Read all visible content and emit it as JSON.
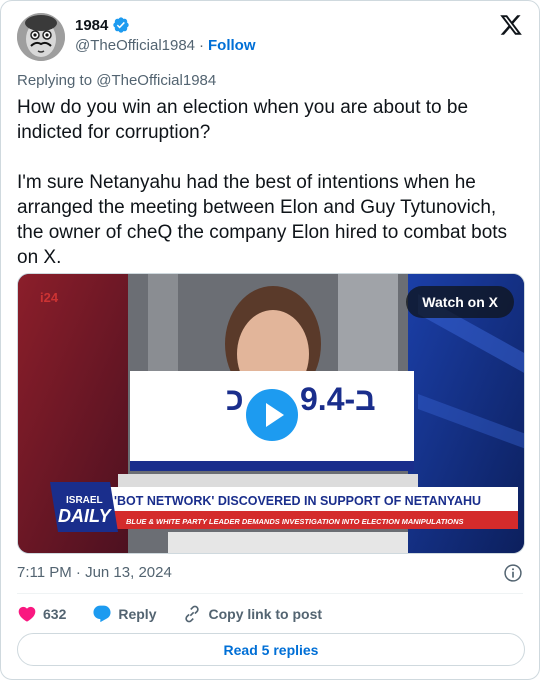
{
  "author": {
    "name": "1984",
    "handle": "@TheOfficial1984",
    "separator": "·",
    "follow_label": "Follow"
  },
  "replying_to": "Replying to @TheOfficial1984",
  "tweet_text": "How do you win an election when you are about to be indicted for corruption?\n\nI'm sure Netanyahu had the best of intentions when he arranged the meeting between Elon and Guy Tytunovich, the owner of cheQ the company Elon hired to combat bots on X.",
  "media": {
    "watch_label": "Watch on X",
    "channel_logo": "i24",
    "headline_number": "9.4-ב",
    "headline_prefix": "כ",
    "show_brand_line1": "ISRAEL",
    "show_brand_line2": "DAILY",
    "headline": "'BOT NETWORK' DISCOVERED IN SUPPORT OF NETANYAHU",
    "subheadline": "BLUE & WHITE PARTY LEADER DEMANDS INVESTIGATION INTO ELECTION MANIPULATIONS"
  },
  "timestamp": "7:11 PM · Jun 13, 2024",
  "actions": {
    "likes": "632",
    "reply_label": "Reply",
    "copy_label": "Copy link to post"
  },
  "read_replies_label": "Read 5 replies",
  "colors": {
    "accent": "#1d9bf0",
    "link": "#006fd6",
    "like": "#f91880",
    "muted": "#536471"
  },
  "icons": [
    "verified-badge-icon",
    "x-logo-icon",
    "play-icon",
    "info-icon",
    "heart-icon",
    "reply-icon",
    "link-icon"
  ]
}
